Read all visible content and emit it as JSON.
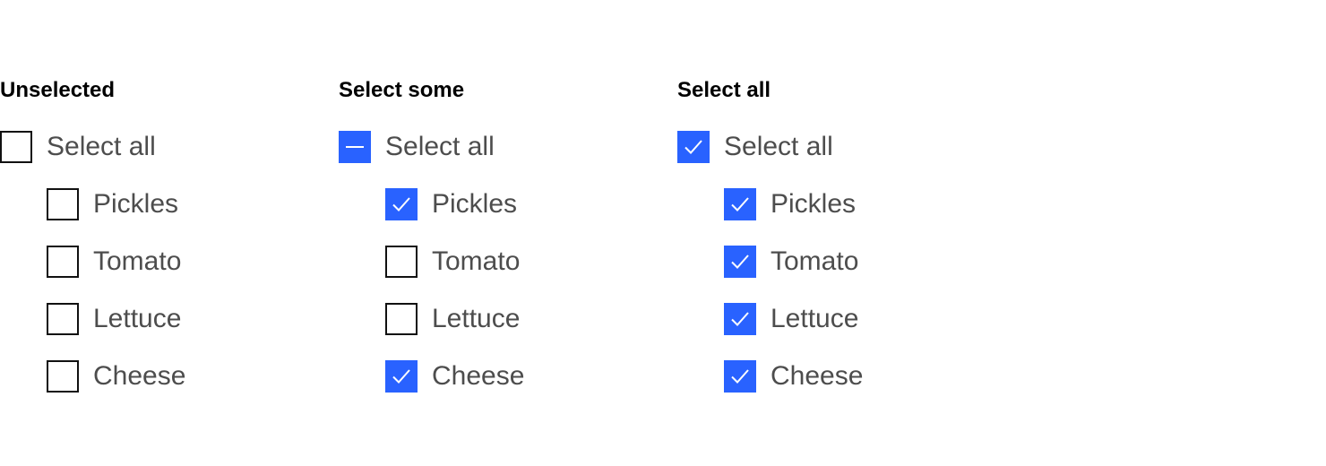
{
  "accent_color": "#2962ff",
  "groups": [
    {
      "heading": "Unselected",
      "parent": {
        "label": "Select all",
        "state": "unchecked"
      },
      "items": [
        {
          "label": "Pickles",
          "checked": false
        },
        {
          "label": "Tomato",
          "checked": false
        },
        {
          "label": "Lettuce",
          "checked": false
        },
        {
          "label": "Cheese",
          "checked": false
        }
      ]
    },
    {
      "heading": "Select some",
      "parent": {
        "label": "Select all",
        "state": "indeterminate"
      },
      "items": [
        {
          "label": "Pickles",
          "checked": true
        },
        {
          "label": "Tomato",
          "checked": false
        },
        {
          "label": "Lettuce",
          "checked": false
        },
        {
          "label": "Cheese",
          "checked": true
        }
      ]
    },
    {
      "heading": "Select all",
      "parent": {
        "label": "Select all",
        "state": "checked"
      },
      "items": [
        {
          "label": "Pickles",
          "checked": true
        },
        {
          "label": "Tomato",
          "checked": true
        },
        {
          "label": "Lettuce",
          "checked": true
        },
        {
          "label": "Cheese",
          "checked": true
        }
      ]
    }
  ]
}
